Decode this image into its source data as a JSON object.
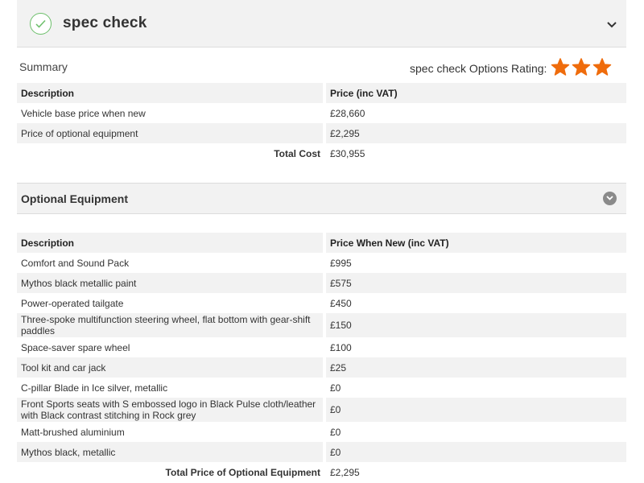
{
  "header": {
    "title": "spec check"
  },
  "summary": {
    "label": "Summary",
    "rating_label": "spec check Options Rating:",
    "rating_stars": 3,
    "rating_max": 3,
    "columns": [
      "Description",
      "Price (inc VAT)"
    ],
    "rows": [
      [
        "Vehicle base price when new",
        "£28,660"
      ],
      [
        "Price of optional equipment",
        "£2,295"
      ]
    ],
    "total_label": "Total Cost",
    "total_value": "£30,955"
  },
  "optional": {
    "title": "Optional Equipment",
    "columns": [
      "Description",
      "Price When New (inc VAT)"
    ],
    "rows": [
      [
        "Comfort and Sound Pack",
        "£995"
      ],
      [
        "Mythos black metallic paint",
        "£575"
      ],
      [
        "Power-operated tailgate",
        "£450"
      ],
      [
        "Three-spoke multifunction steering wheel, flat bottom with gear-shift paddles",
        "£150"
      ],
      [
        "Space-saver spare wheel",
        "£100"
      ],
      [
        "Tool kit and car jack",
        "£25"
      ],
      [
        "C-pillar Blade in Ice silver, metallic",
        "£0"
      ],
      [
        "Front Sports seats with S embossed logo in Black Pulse cloth/leather with Black contrast stitching in Rock grey",
        "£0"
      ],
      [
        "Matt-brushed aluminium",
        "£0"
      ],
      [
        "Mythos black, metallic",
        "£0"
      ]
    ],
    "total_label": "Total Price of Optional Equipment",
    "total_value": "£2,295"
  },
  "colors": {
    "star": "#ef6c0c",
    "check": "#6cbf6a",
    "row_shade": "#f2f2f2"
  },
  "icons": [
    "check-circle-icon",
    "chevron-down-icon",
    "star-icon",
    "collapse-toggle-icon"
  ]
}
